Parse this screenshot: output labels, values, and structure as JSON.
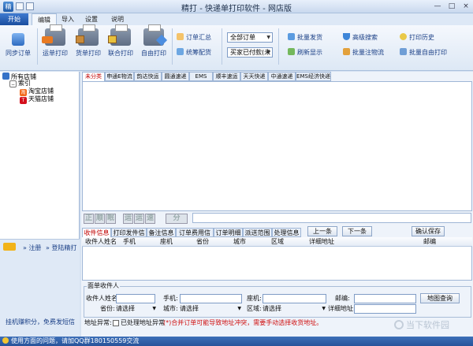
{
  "window": {
    "title": "精打 - 快递单打印软件 - 网店版",
    "minimize": "—",
    "maximize": "□",
    "close": "×"
  },
  "menu": {
    "start": "开始",
    "tabs": [
      "编辑",
      "导入",
      "设置",
      "说明"
    ]
  },
  "ribbon": {
    "sync": "同步订单",
    "waybill": "运单打印",
    "delivery": "货单打印",
    "combined": "联合打印",
    "free": "自由打印",
    "order_summary": "订单汇总",
    "stock": "统筹配货",
    "order_filter": "全部订单",
    "pay_filter": "买家已付款(未",
    "batch_ship": "批量发货",
    "refresh": "刷新显示",
    "adv_search": "高级搜索",
    "batch_remark": "批量注物流",
    "print_history": "打印历史",
    "batch_free": "批量自由打印"
  },
  "sidebar": {
    "root": "所有店铺",
    "group": "索引",
    "shops": [
      "淘宝店铺",
      "天猫店铺"
    ],
    "register": "注册",
    "login": "登陆精打",
    "earn": "挂机赚积分，免费发短信"
  },
  "courier_tabs": [
    "未分类",
    "申通E物流",
    "韵达快运",
    "圆通速递",
    "EMS",
    "顺丰速运",
    "天天快递",
    "中通速递",
    "EMS经济快递"
  ],
  "pager": {
    "buttons": [
      "正",
      "顺",
      "眠",
      "运",
      "运",
      "速",
      "分"
    ]
  },
  "detail_tabs": [
    "收件信息",
    "打印发件信息",
    "备注信息",
    "订单费用信息",
    "订单明细",
    "派送范围",
    "处理信息"
  ],
  "nav": {
    "prev": "上一条",
    "next": "下一条",
    "confirm": "确认保存"
  },
  "grid_headers": [
    "收件人姓名",
    "手机",
    "座机",
    "省份",
    "城市",
    "区域",
    "详细地址",
    "邮编"
  ],
  "receiver": {
    "legend": "面单收件人",
    "name_label": "收件人姓名:",
    "mobile_label": "手机:",
    "phone_label": "座机:",
    "zip_label": "邮编:",
    "map_btn": "地图查询",
    "province_label": "省份:",
    "city_label": "城市:",
    "district_label": "区域:",
    "addr_label": "详细地址:",
    "select_placeholder": "请选择"
  },
  "abnormal": {
    "label": "地址异常:",
    "checkbox": "已处理地址异常",
    "warning": "(*)合并订单可能导致地址冲突，需要手动选择收货地址。"
  },
  "status": {
    "text": "使用方面的问题，请加QQ群180150559交流"
  },
  "watermark": "当下软件园"
}
